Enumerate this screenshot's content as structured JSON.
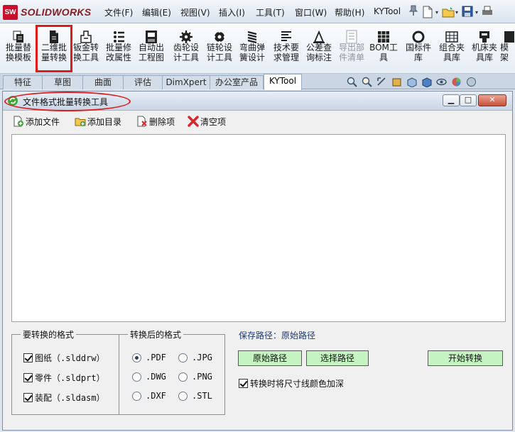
{
  "app": {
    "logo_mark": "SW",
    "logo_text": "SOLIDWORKS"
  },
  "menu": {
    "items": [
      "文件(F)",
      "编辑(E)",
      "视图(V)",
      "插入(I)",
      "工具(T)",
      "窗口(W)",
      "帮助(H)",
      "KYTool"
    ]
  },
  "ribbon": {
    "tools": [
      {
        "label": "批量替\n换模板",
        "icon": "replace-template-icon"
      },
      {
        "label": "二维批\n量转换",
        "icon": "batch-convert-icon"
      },
      {
        "label": "钣金转\n换工具",
        "icon": "sheet-metal-icon"
      },
      {
        "label": "批量修\n改属性",
        "icon": "edit-properties-icon"
      },
      {
        "label": "自动出\n工程图",
        "icon": "drawing-icon"
      },
      {
        "label": "齿轮设\n计工具",
        "icon": "gear-icon"
      },
      {
        "label": "链轮设\n计工具",
        "icon": "sprocket-icon"
      },
      {
        "label": "弯曲弹\n簧设计",
        "icon": "spring-icon"
      },
      {
        "label": "技术要\n求管理",
        "icon": "text-lines-icon"
      },
      {
        "label": "公差查\n询标注",
        "icon": "tolerance-icon"
      },
      {
        "label": "导出部\n件清单",
        "icon": "export-list-icon"
      },
      {
        "label": "BOM工\n具",
        "icon": "bom-icon"
      },
      {
        "label": "国标件\n库",
        "icon": "standard-parts-icon"
      },
      {
        "label": "组合夹\n具库",
        "icon": "fixture-icon"
      },
      {
        "label": "机床夹\n具库",
        "icon": "machine-fixture-icon"
      },
      {
        "label": "模架",
        "icon": "mold-base-icon"
      }
    ]
  },
  "tabs": [
    {
      "label": "特征",
      "active": false
    },
    {
      "label": "草图",
      "active": false
    },
    {
      "label": "曲面",
      "active": false
    },
    {
      "label": "评估",
      "active": false
    },
    {
      "label": "DimXpert",
      "active": false
    },
    {
      "label": "办公室产品",
      "active": false
    },
    {
      "label": "KYTool",
      "active": true
    }
  ],
  "dialog": {
    "title": "文件格式批量转换工具",
    "toolbar": {
      "add_file": "添加文件",
      "add_dir": "添加目录",
      "delete_item": "删除项",
      "clear": "清空项"
    },
    "source_group": {
      "title": "要转换的格式",
      "options": [
        {
          "label": "图纸（.slddrw）",
          "checked": true
        },
        {
          "label": "零件（.sldprt）",
          "checked": true
        },
        {
          "label": "装配（.sldasm）",
          "checked": true
        }
      ]
    },
    "target_group": {
      "title": "转换后的格式",
      "options": [
        {
          "label": ".PDF",
          "checked": true
        },
        {
          "label": ".JPG",
          "checked": false
        },
        {
          "label": ".DWG",
          "checked": false
        },
        {
          "label": ".PNG",
          "checked": false
        },
        {
          "label": ".DXF",
          "checked": false
        },
        {
          "label": ".STL",
          "checked": false
        }
      ]
    },
    "save_path_label": "保存路径：原始路径",
    "buttons": {
      "original_path": "原始路径",
      "choose_path": "选择路径",
      "start": "开始转换"
    },
    "dim_color_check": {
      "label": "转换时将尺寸线颜色加深",
      "checked": true
    }
  },
  "colors": {
    "highlight": "#e01b1b",
    "button_green": "#c6f3c2",
    "save_path_text": "#1a3a7a"
  }
}
